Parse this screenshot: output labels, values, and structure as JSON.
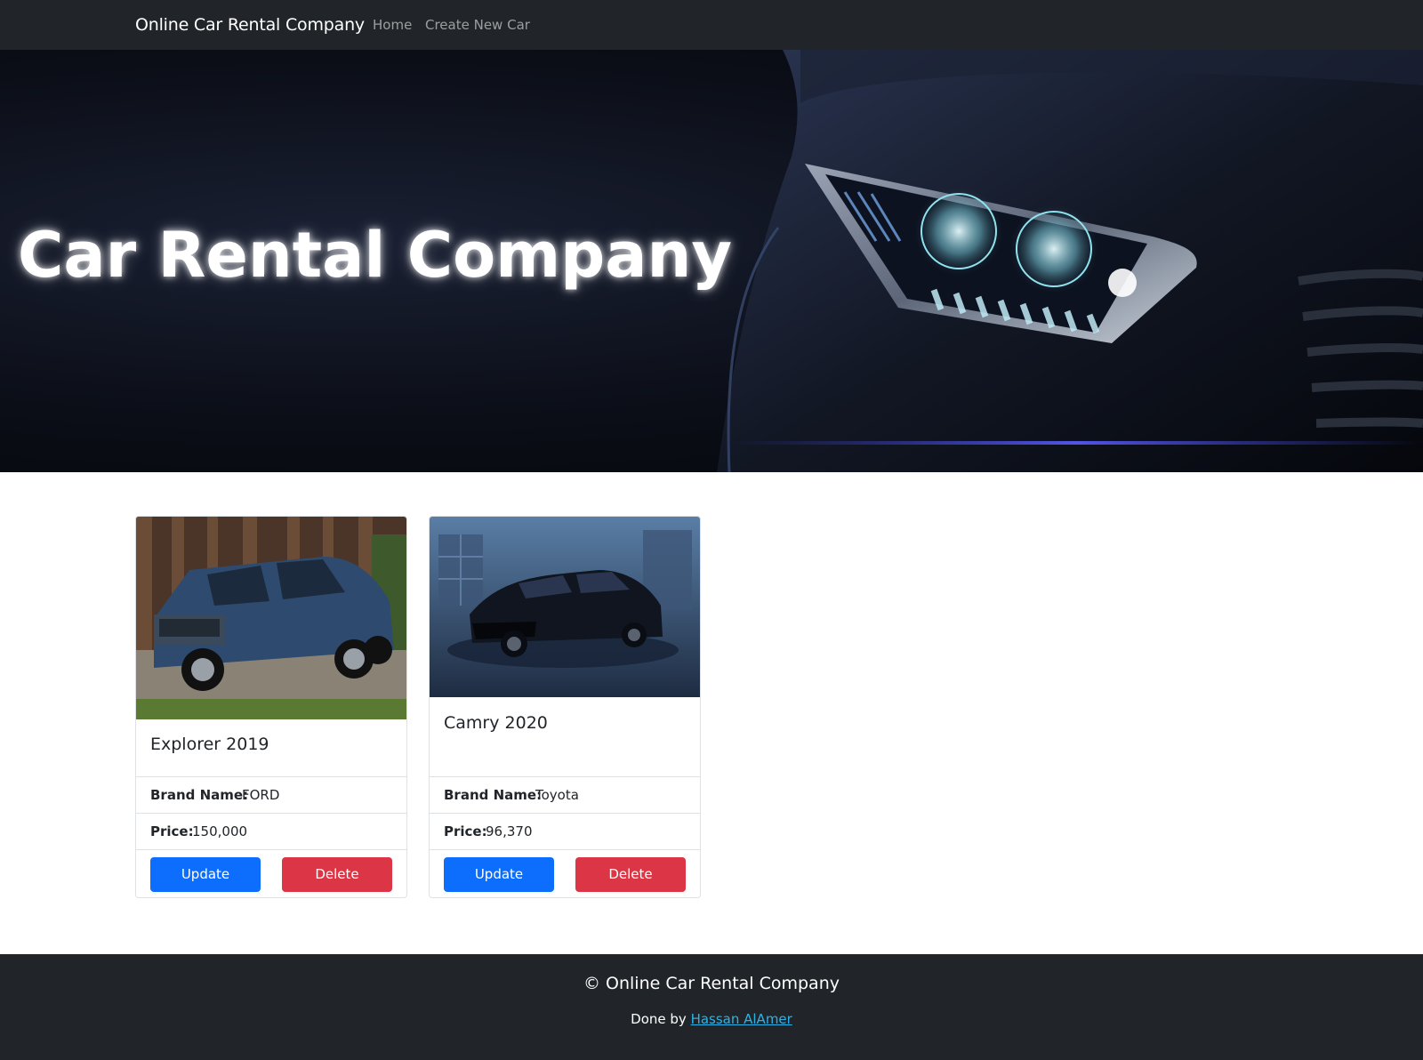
{
  "navbar": {
    "brand": "Online Car Rental Company",
    "links": [
      "Home",
      "Create New Car"
    ]
  },
  "hero": {
    "title": "Car Rental Company"
  },
  "cars": [
    {
      "title": "Explorer 2019",
      "brand_label": "Brand Name:",
      "brand": "FORD",
      "price_label": "Price:",
      "price": "150,000",
      "update_label": "Update",
      "delete_label": "Delete",
      "image": "blue Ford Explorer SUV in front of a wooden barn"
    },
    {
      "title": "Camry 2020",
      "brand_label": "Brand Name:",
      "brand": "Toyota",
      "price_label": "Price:",
      "price": "96,370",
      "update_label": "Update",
      "delete_label": "Delete",
      "image": "black Toyota Camry sedan in a dim blue warehouse"
    }
  ],
  "footer": {
    "copyright": "© Online Car Rental Company",
    "credit_prefix": "Done by",
    "credit_name": "Hassan AlAmer"
  },
  "colors": {
    "navbar_bg": "#212529",
    "primary": "#0d6efd",
    "danger": "#dc3545",
    "link": "#2bb3e8"
  }
}
